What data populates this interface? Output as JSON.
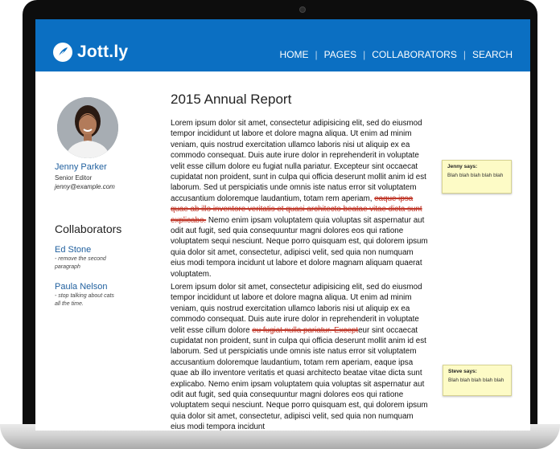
{
  "brand": {
    "name": "Jott.ly"
  },
  "nav": {
    "items": [
      "HOME",
      "PAGES",
      "COLLABORATORS",
      "SEARCH"
    ]
  },
  "user": {
    "name": "Jenny Parker",
    "role": "Senior Editor",
    "email": "jenny@example.com"
  },
  "collaborators": {
    "heading": "Collaborators",
    "items": [
      {
        "name": "Ed Stone",
        "note": "- remove the second paragraph"
      },
      {
        "name": "Paula Nelson",
        "note": "- stop talking about cats all the time."
      }
    ]
  },
  "document": {
    "title": "2015 Annual Report",
    "p1": {
      "before": "Lorem ipsum dolor sit amet, consectetur adipisicing elit, sed do eiusmod tempor incididunt ut labore et dolore magna aliqua. Ut enim ad minim veniam, quis nostrud exercitation ullamco laboris nisi ut aliquip ex ea commodo consequat. Duis aute irure dolor in reprehenderit in voluptate velit esse cillum dolore eu fugiat nulla pariatur. Excepteur sint occaecat cupidatat non proident, sunt in culpa qui officia deserunt mollit anim id est laborum. Sed ut perspiciatis unde omnis iste natus error sit voluptatem accusantium doloremque laudantium, totam rem aperiam, ",
      "struck": "eaque ipsa quae ab illo inventore veritatis et quasi architecto beatae vitae dicta sunt explicabo.",
      "after": " Nemo enim ipsam voluptatem quia voluptas sit aspernatur aut odit aut fugit, sed quia consequuntur magni dolores eos qui ratione voluptatem sequi nesciunt. Neque porro quisquam est, qui dolorem ipsum quia dolor sit amet, consectetur, adipisci velit, sed quia non numquam eius modi tempora incidunt ut labore et dolore magnam aliquam quaerat voluptatem."
    },
    "p2": {
      "before": "Lorem ipsum dolor sit amet, consectetur adipisicing elit, sed do eiusmod tempor incididunt ut labore et dolore magna aliqua. Ut enim ad minim veniam, quis nostrud exercitation ullamco laboris nisi ut aliquip ex ea commodo consequat. Duis aute irure dolor in reprehenderit in voluptate velit esse cillum dolore ",
      "struck": "eu fugiat nulla pariatur. Except",
      "after": "eur sint occaecat cupidatat non proident, sunt in culpa qui officia deserunt mollit anim id est laborum. Sed ut perspiciatis unde omnis iste natus error sit voluptatem accusantium doloremque laudantium, totam rem aperiam, eaque ipsa quae ab illo inventore veritatis et quasi architecto beatae vitae dicta sunt explicabo. Nemo enim ipsam voluptatem quia voluptas sit aspernatur aut odit aut fugit, sed quia consequuntur magni dolores eos qui ratione voluptatem sequi nesciunt. Neque porro quisquam est, qui dolorem ipsum quia dolor sit amet, consectetur, adipisci velit, sed quia non numquam eius modi tempora incidunt"
    }
  },
  "comments": [
    {
      "author": "Jenny says:",
      "text": "Blah blah blah blah blah"
    },
    {
      "author": "Steve says:",
      "text": "Blah blah blah blah blah"
    }
  ],
  "colors": {
    "header": "#0b6fc2",
    "link": "#1f5f9e",
    "strike": "#c0392b",
    "note": "#fdfbc6"
  }
}
